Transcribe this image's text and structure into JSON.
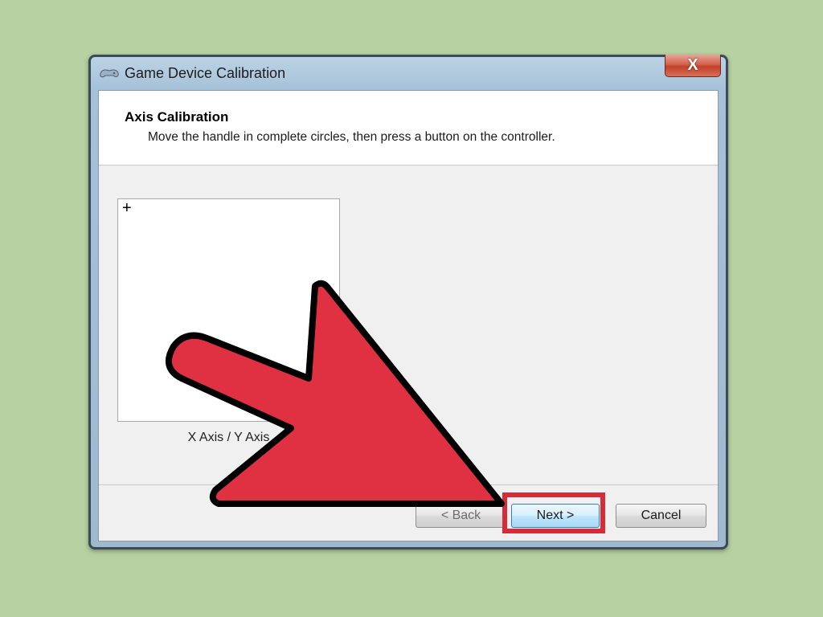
{
  "window": {
    "title": "Game Device Calibration",
    "close_label": "X"
  },
  "header": {
    "title": "Axis Calibration",
    "description": "Move the handle in complete circles, then press a button on the controller."
  },
  "axis": {
    "crosshair": "+",
    "label": "X Axis / Y Axis"
  },
  "buttons": {
    "back": "< Back",
    "next": "Next >",
    "cancel": "Cancel"
  },
  "colors": {
    "background": "#b7d1a2",
    "arrow": "#e03142",
    "highlight": "#d62c3a"
  }
}
